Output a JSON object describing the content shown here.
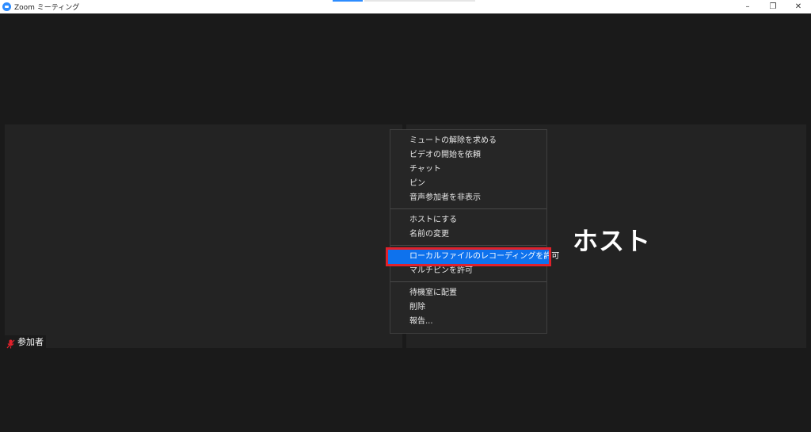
{
  "window": {
    "title": "Zoom ミーティング",
    "minimize_glyph": "–",
    "restore_glyph": "❐",
    "close_glyph": "✕"
  },
  "video": {
    "host_label": "ホスト",
    "participant_name": "参加者"
  },
  "context_menu": {
    "groups": [
      [
        "ミュートの解除を求める",
        "ビデオの開始を依頼",
        "チャット",
        "ピン",
        "音声参加者を非表示"
      ],
      [
        "ホストにする",
        "名前の変更"
      ],
      [
        "ローカルファイルのレコーディングを許可",
        "マルチピンを許可"
      ],
      [
        "待機室に配置",
        "削除",
        "報告..."
      ]
    ],
    "highlighted_item": "ローカルファイルのレコーディングを許可"
  },
  "colors": {
    "accent": "#0e72ed",
    "highlight_border": "#e0212b",
    "muted_mic": "#e0212b",
    "logo": "#2d8cff"
  },
  "icons": [
    "zoom-logo-icon",
    "minimize-icon",
    "restore-icon",
    "close-icon",
    "muted-mic-icon"
  ]
}
